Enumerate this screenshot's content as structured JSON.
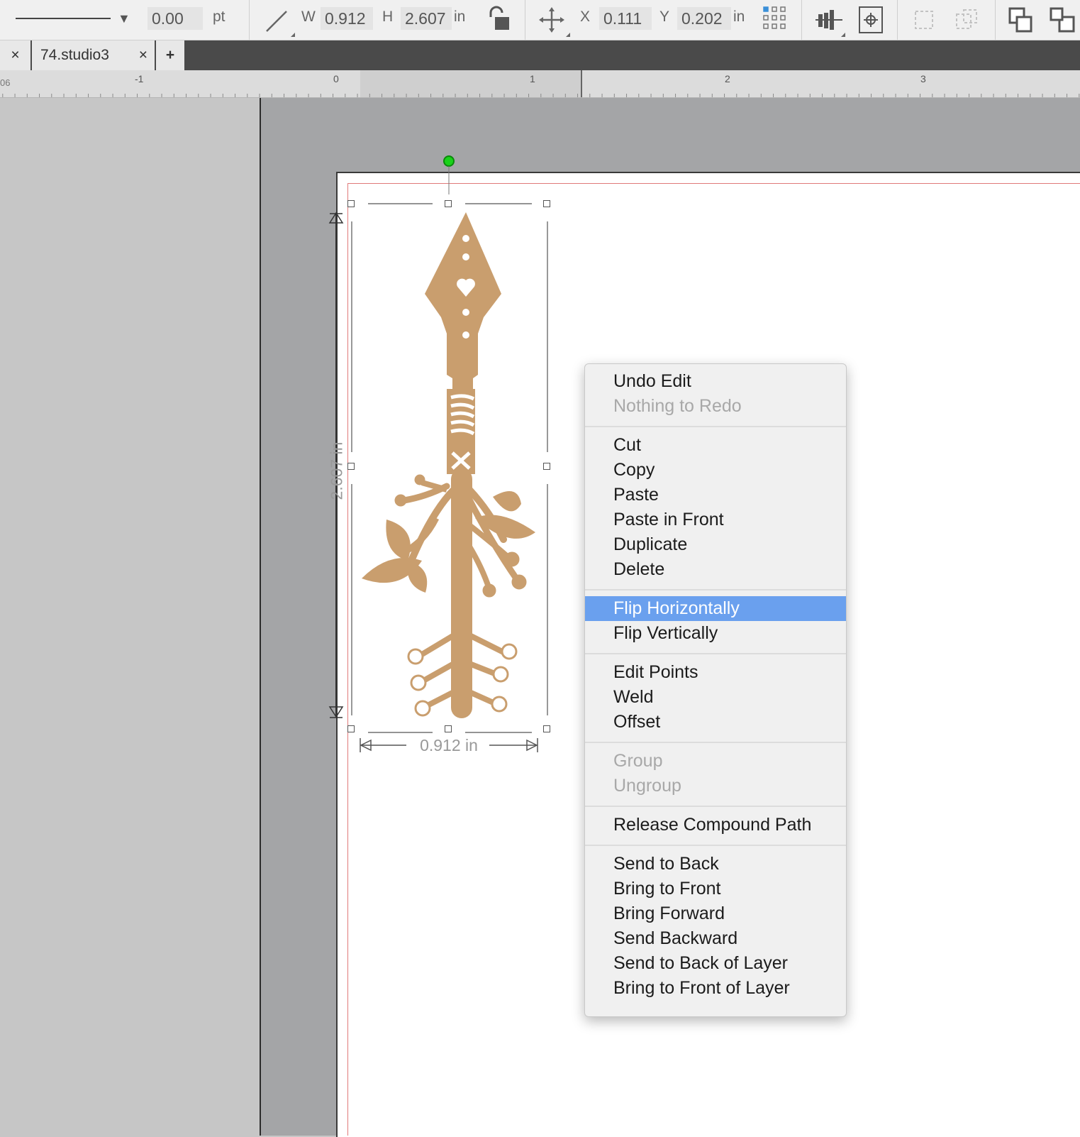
{
  "toolbar": {
    "line_width_value": "0.00",
    "line_width_unit": "pt",
    "w_label": "W",
    "w_value": "0.912",
    "h_label": "H",
    "h_value": "2.607",
    "size_unit": "in",
    "x_label": "X",
    "x_value": "0.111",
    "y_label": "Y",
    "y_value": "0.202",
    "pos_unit": "in"
  },
  "tabs": {
    "close_left": "×",
    "document_name": "74.studio3",
    "close_doc": "×",
    "add": "+"
  },
  "ruler": {
    "ticks": [
      "06",
      "-1",
      "0",
      "1",
      "2",
      "3"
    ]
  },
  "canvas": {
    "width_dimension": "0.912 in",
    "height_dimension": "2.607 in",
    "artwork_color": "#c99e6e"
  },
  "context_menu": {
    "groups": [
      {
        "items": [
          {
            "label": "Undo Edit",
            "enabled": true
          },
          {
            "label": "Nothing to Redo",
            "enabled": false
          }
        ]
      },
      {
        "items": [
          {
            "label": "Cut",
            "enabled": true
          },
          {
            "label": "Copy",
            "enabled": true
          },
          {
            "label": "Paste",
            "enabled": true
          },
          {
            "label": "Paste in Front",
            "enabled": true
          },
          {
            "label": "Duplicate",
            "enabled": true
          },
          {
            "label": "Delete",
            "enabled": true
          }
        ]
      },
      {
        "items": [
          {
            "label": "Flip Horizontally",
            "enabled": true,
            "highlighted": true
          },
          {
            "label": "Flip Vertically",
            "enabled": true
          }
        ]
      },
      {
        "items": [
          {
            "label": "Edit Points",
            "enabled": true
          },
          {
            "label": "Weld",
            "enabled": true
          },
          {
            "label": "Offset",
            "enabled": true
          }
        ]
      },
      {
        "items": [
          {
            "label": "Group",
            "enabled": false
          },
          {
            "label": "Ungroup",
            "enabled": false
          }
        ]
      },
      {
        "items": [
          {
            "label": "Release Compound Path",
            "enabled": true
          }
        ]
      },
      {
        "items": [
          {
            "label": "Send to Back",
            "enabled": true
          },
          {
            "label": "Bring to Front",
            "enabled": true
          },
          {
            "label": "Bring Forward",
            "enabled": true
          },
          {
            "label": "Send Backward",
            "enabled": true
          },
          {
            "label": "Send to Back of Layer",
            "enabled": true
          },
          {
            "label": "Bring to Front of Layer",
            "enabled": true
          }
        ]
      }
    ],
    "highlight_color": "#6aa0ee"
  }
}
